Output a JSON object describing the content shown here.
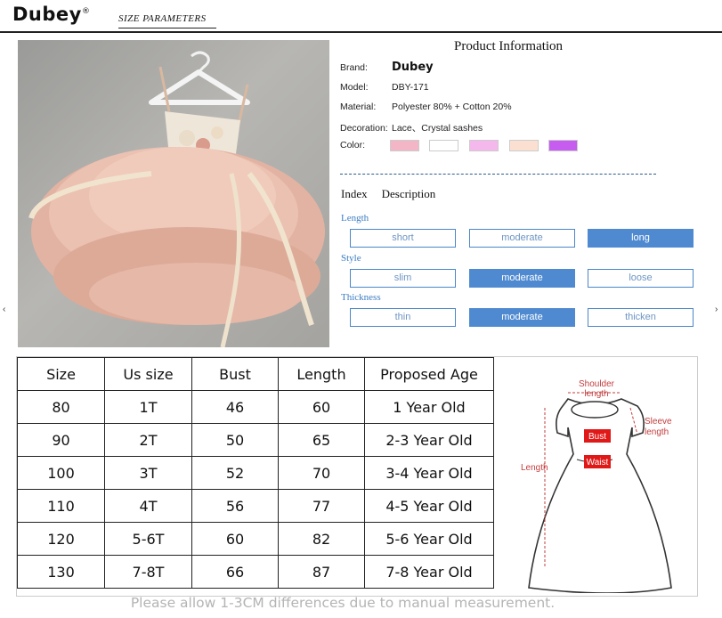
{
  "header": {
    "brand": "Dubey",
    "brand_mark": "®",
    "section_title": "SIZE  PARAMETERS"
  },
  "product_info": {
    "title": "Product  Information",
    "brand_label": "Brand:",
    "brand_value": "Dubey",
    "model_label": "Model:",
    "model_value": "DBY-171",
    "material_label": "Material:",
    "material_value": "Polyester 80% + Cotton 20%",
    "decoration_label": "Decoration:",
    "decoration_value": "Lace、Crystal sashes",
    "color_label": "Color:",
    "colors": [
      "#f2b6c6",
      "#ffffff",
      "#f4b8ec",
      "#fbe0d2",
      "#c65cf0"
    ]
  },
  "index": {
    "heading_index": "Index",
    "heading_description": "Description",
    "categories": [
      {
        "name": "Length",
        "options": [
          "short",
          "moderate",
          "long"
        ],
        "selected": 2
      },
      {
        "name": "Style",
        "options": [
          "slim",
          "moderate",
          "loose"
        ],
        "selected": 1
      },
      {
        "name": "Thickness",
        "options": [
          "thin",
          "moderate",
          "thicken"
        ],
        "selected": 1
      }
    ]
  },
  "size_table": {
    "headers": [
      "Size",
      "Us size",
      "Bust",
      "Length",
      "Proposed Age"
    ],
    "rows": [
      [
        "80",
        "1T",
        "46",
        "60",
        "1 Year Old"
      ],
      [
        "90",
        "2T",
        "50",
        "65",
        "2-3 Year Old"
      ],
      [
        "100",
        "3T",
        "52",
        "70",
        "3-4 Year Old"
      ],
      [
        "110",
        "4T",
        "56",
        "77",
        "4-5 Year Old"
      ],
      [
        "120",
        "5-6T",
        "60",
        "82",
        "5-6 Year Old"
      ],
      [
        "130",
        "7-8T",
        "66",
        "87",
        "7-8 Year Old"
      ]
    ]
  },
  "diagram": {
    "shoulder_label_1": "Shoulder",
    "shoulder_label_2": "length",
    "sleeve_label_1": "Sleeve",
    "sleeve_label_2": "length",
    "bust_label": "Bust",
    "waist_label": "Waist",
    "length_label": "Length"
  },
  "note": "Please allow 1-3CM differences due to manual measurement."
}
